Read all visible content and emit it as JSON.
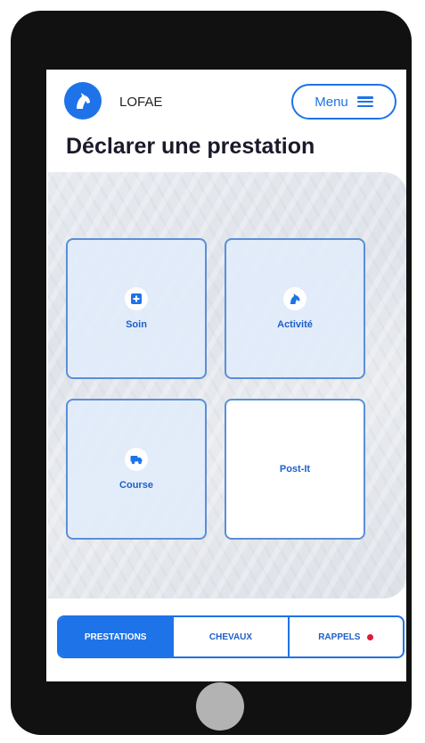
{
  "app": {
    "brand": "LOFAE",
    "menu_label": "Menu"
  },
  "page": {
    "title": "Déclarer une prestation"
  },
  "tiles": [
    {
      "label": "Soin",
      "icon": "medical-plus-icon"
    },
    {
      "label": "Activité",
      "icon": "horse-head-icon"
    },
    {
      "label": "Course",
      "icon": "truck-icon"
    },
    {
      "label": "Post-It",
      "icon": ""
    }
  ],
  "tabs": [
    {
      "label": "PRESTATIONS",
      "active": true
    },
    {
      "label": "CHEVAUX",
      "active": false
    },
    {
      "label": "RAPPELS",
      "active": false,
      "badge_dot": true
    }
  ],
  "colors": {
    "accent": "#1e73e8",
    "notification_dot": "#e0183c",
    "device_frame": "#111111"
  }
}
